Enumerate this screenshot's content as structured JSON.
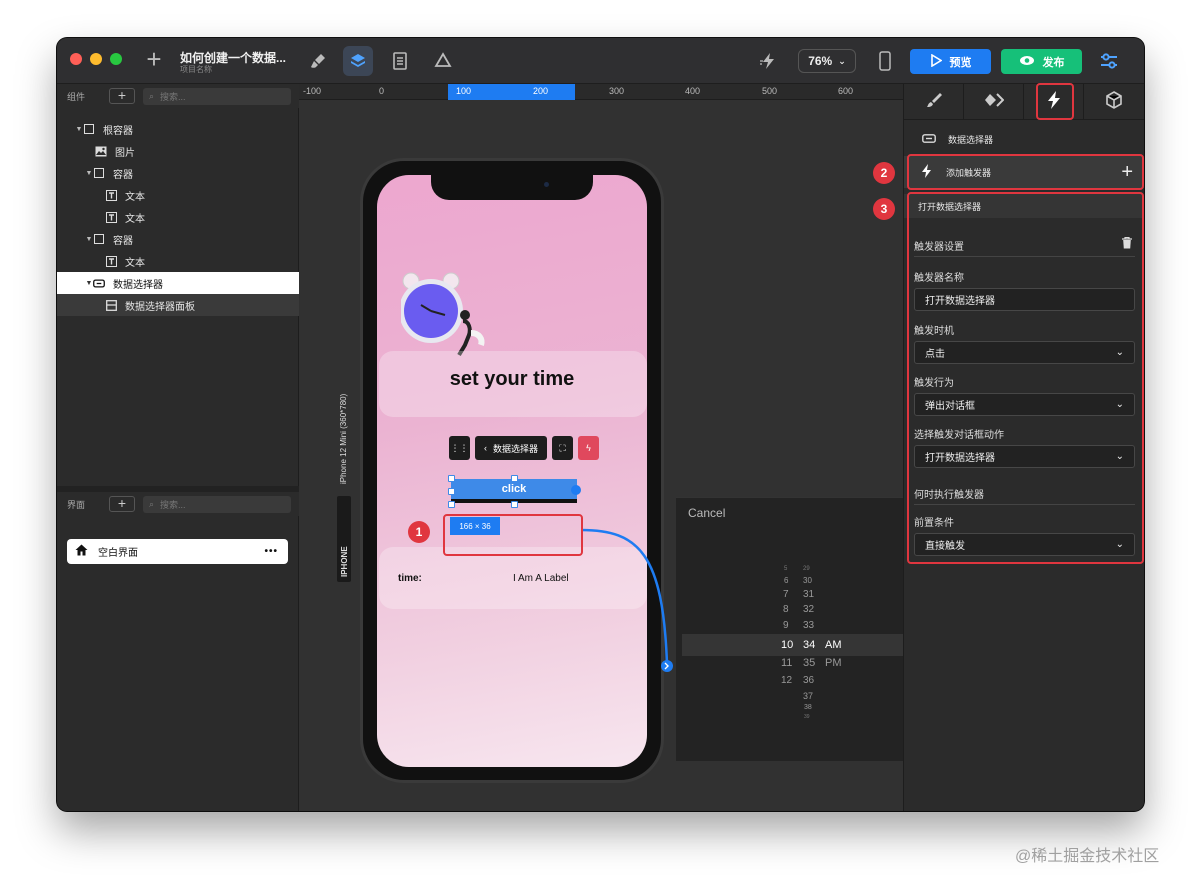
{
  "window": {
    "title": "如何创建一个数据...",
    "subtitle": "项目名称"
  },
  "toolbar": {
    "zoom": "76%",
    "preview_label": "预览",
    "publish_label": "发布"
  },
  "left_panel": {
    "components_label": "组件",
    "search_placeholder": "搜索...",
    "tree": [
      {
        "label": "根容器",
        "icon": "container-icon"
      },
      {
        "label": "图片",
        "icon": "image-icon"
      },
      {
        "label": "容器",
        "icon": "container-icon"
      },
      {
        "label": "文本",
        "icon": "text-icon"
      },
      {
        "label": "文本",
        "icon": "text-icon"
      },
      {
        "label": "容器",
        "icon": "container-icon"
      },
      {
        "label": "文本",
        "icon": "text-icon"
      },
      {
        "label": "数据选择器",
        "icon": "picker-icon"
      },
      {
        "label": "数据选择器面板",
        "icon": "panel-icon"
      }
    ],
    "pages_label": "界面",
    "pages_search_placeholder": "搜索...",
    "page_item": "空白界面"
  },
  "ruler": {
    "ticks": [
      "-100",
      "0",
      "100",
      "200",
      "300",
      "400",
      "500",
      "600"
    ]
  },
  "canvas": {
    "device_label": "iPhone 12 Mini (360*780)",
    "device_type": "IPHONE",
    "headline": "set your time",
    "component_chip": "数据选择器",
    "button_label": "click",
    "dimensions": "166 × 36",
    "time_label": "time:",
    "label_text": "I Am A Label"
  },
  "picker": {
    "cancel": "Cancel",
    "rows": [
      {
        "h": "5",
        "m": "29",
        "p": ""
      },
      {
        "h": "6",
        "m": "30",
        "p": ""
      },
      {
        "h": "7",
        "m": "31",
        "p": ""
      },
      {
        "h": "8",
        "m": "32",
        "p": ""
      },
      {
        "h": "9",
        "m": "33",
        "p": ""
      },
      {
        "h": "10",
        "m": "34",
        "p": "AM"
      },
      {
        "h": "11",
        "m": "35",
        "p": "PM"
      },
      {
        "h": "12",
        "m": "36",
        "p": ""
      },
      {
        "h": "",
        "m": "37",
        "p": ""
      },
      {
        "h": "",
        "m": "38",
        "p": ""
      },
      {
        "h": "",
        "m": "39",
        "p": ""
      }
    ]
  },
  "right_panel": {
    "component_name": "数据选择器",
    "add_trigger": "添加触发器",
    "trigger_item": "打开数据选择器",
    "trigger_settings": "触发器设置",
    "name_label": "触发器名称",
    "name_value": "打开数据选择器",
    "timing_label": "触发时机",
    "timing_value": "点击",
    "action_label": "触发行为",
    "action_value": "弹出对话框",
    "dialog_action_label": "选择触发对话框动作",
    "dialog_action_value": "打开数据选择器",
    "when_label": "何时执行触发器",
    "precondition_label": "前置条件",
    "precondition_value": "直接触发"
  },
  "annotations": {
    "badge1": "1",
    "badge2": "2",
    "badge3": "3"
  },
  "watermark": "@稀土掘金技术社区",
  "colors": {
    "accent_blue": "#1e7cf2",
    "publish_green": "#16c079",
    "highlight_red": "#e0363f"
  }
}
